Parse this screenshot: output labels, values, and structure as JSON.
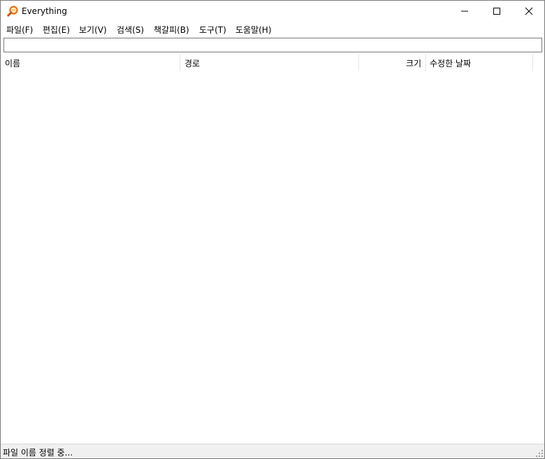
{
  "window": {
    "title": "Everything",
    "accent_icon_color": "#e8791b"
  },
  "menubar": {
    "items": [
      {
        "label": "파일(F)"
      },
      {
        "label": "편집(E)"
      },
      {
        "label": "보기(V)"
      },
      {
        "label": "검색(S)"
      },
      {
        "label": "책갈피(B)"
      },
      {
        "label": "도구(T)"
      },
      {
        "label": "도움말(H)"
      }
    ]
  },
  "search": {
    "value": "",
    "placeholder": ""
  },
  "columns": {
    "name": "이름",
    "path": "경로",
    "size": "크기",
    "modified": "수정한 날짜"
  },
  "results": [],
  "statusbar": {
    "text": "파일 이름 정렬 중..."
  }
}
